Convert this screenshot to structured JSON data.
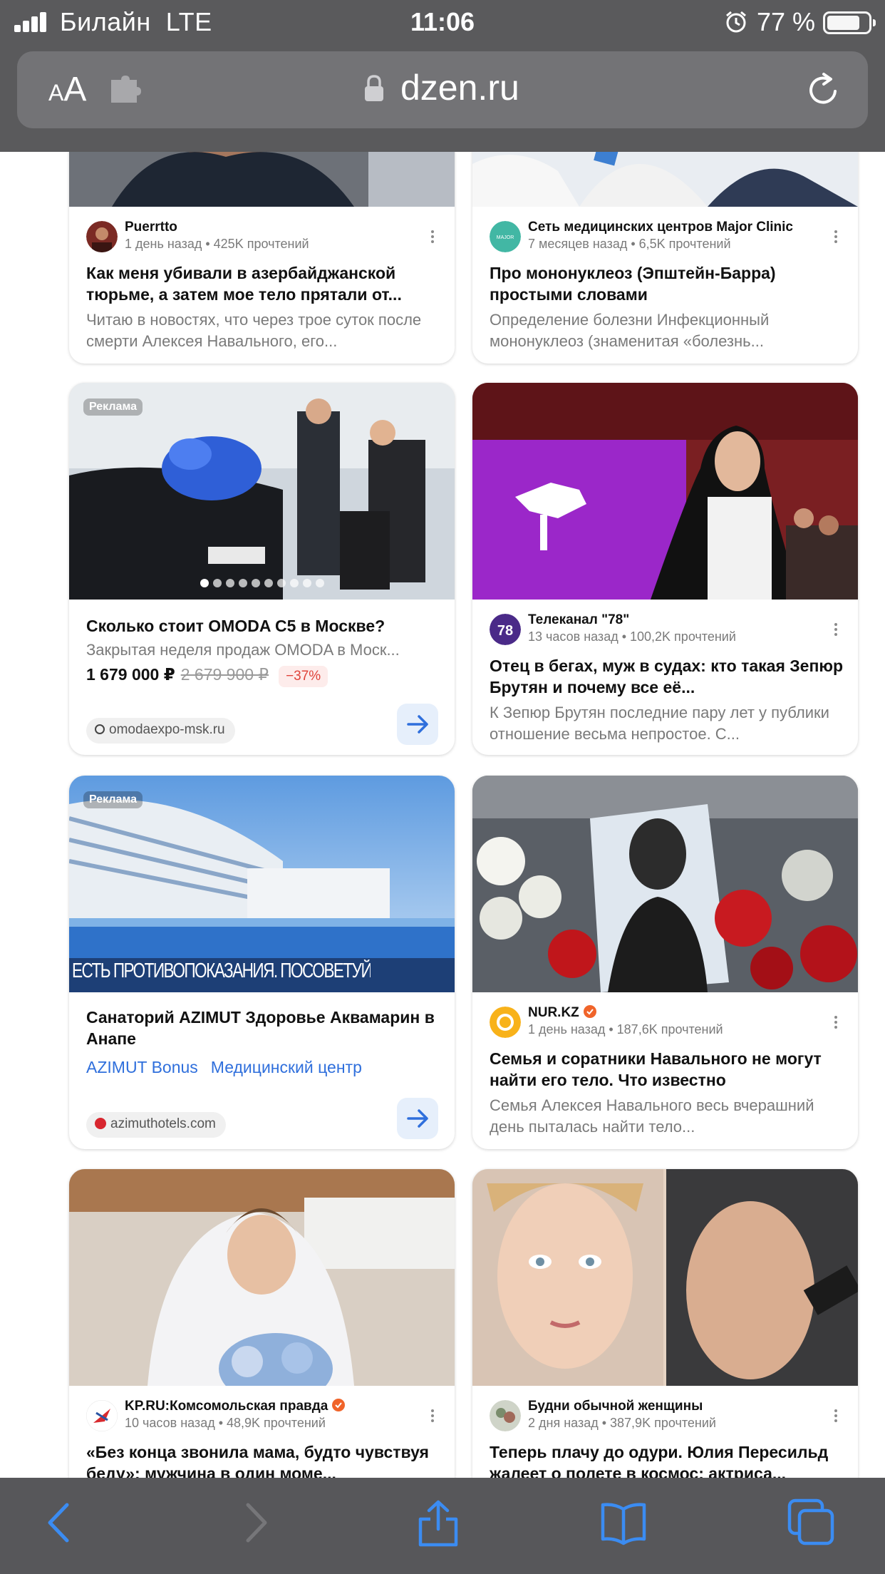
{
  "status_bar": {
    "carrier": "Билайн",
    "network": "LTE",
    "time": "11:06",
    "battery_percent": "77 %",
    "battery_level": 0.77
  },
  "url_bar": {
    "text_size_label": "AA",
    "url": "dzen.ru"
  },
  "cards": [
    {
      "source_name": "Puerrtto",
      "meta": "1 день назад • 425K прочтений",
      "title": "Как меня убивали в азербайджанской тюрьме, а затем мое тело прятали от...",
      "snippet": "Читаю в новостях, что через трое суток после смерти Алексея Навального, его..."
    },
    {
      "source_name": "Сеть медицинских центров Major Clinic",
      "meta": "7 месяцев назад • 6,5K прочтений",
      "title": "Про мононуклеоз (Эпштейн-Барра) простыми словами",
      "snippet": "Определение болезни Инфекционный мононуклеоз (знаменитая «болезнь..."
    },
    {
      "badge": "Реклама",
      "title": "Сколько стоит OMODA C5 в Москве?",
      "snippet": "Закрытая неделя продаж OMODA в Моск...",
      "price": "1 679 000 ₽",
      "old_price": "2 679 900 ₽",
      "discount": "−37%",
      "domain": "omodaexpo-msk.ru",
      "carousel_slides": 10,
      "carousel_active": 1
    },
    {
      "source_name": "Телеканал \"78\"",
      "avatar_text": "78",
      "meta": "13 часов назад • 100,2K прочтений",
      "title": "Отец в бегах, муж в судах: кто такая Зепюр Брутян и почему все её...",
      "snippet": "К Зепюр Брутян последние пару лет у публики отношение весьма непростое. С..."
    },
    {
      "badge": "Реклама",
      "image_caption": "ЕСТЬ ПРОТИВОПОКАЗАНИЯ. ПОСОВЕТУЙТЕСЬ С ВРАЧОМ",
      "title": "Санаторий AZIMUT Здоровье Аквамарин в Анапе",
      "links": [
        "AZIMUT Bonus",
        "Медицинский центр"
      ],
      "domain": "azimuthotels.com"
    },
    {
      "source_name": "NUR.KZ",
      "meta": "1 день назад • 187,6K прочтений",
      "title": "Семья и соратники Навального не могут найти его тело. Что известно",
      "snippet": "Семья Алексея Навального весь вчерашний день пыталась найти тело..."
    },
    {
      "source_name": "KP.RU:Комсомольская правда",
      "meta": "10 часов назад • 48,9K прочтений",
      "title": "«Без конца звонила мама, будто чувствуя беду»: мужчина в один моме..."
    },
    {
      "source_name": "Будни обычной женщины",
      "meta": "2 дня назад • 387,9K прочтений",
      "title": "Теперь плачу до одури. Юлия Пересильд жалеет о полете в космос: актриса..."
    }
  ],
  "colors": {
    "accent_blue": "#2f6fdc",
    "verified_orange": "#f0642a",
    "discount_red": "#e0433a",
    "chrome_gray": "#5a5a5c"
  },
  "icons": {
    "toolbar": [
      "back-icon",
      "forward-icon",
      "share-icon",
      "bookmarks-icon",
      "tabs-icon"
    ]
  }
}
